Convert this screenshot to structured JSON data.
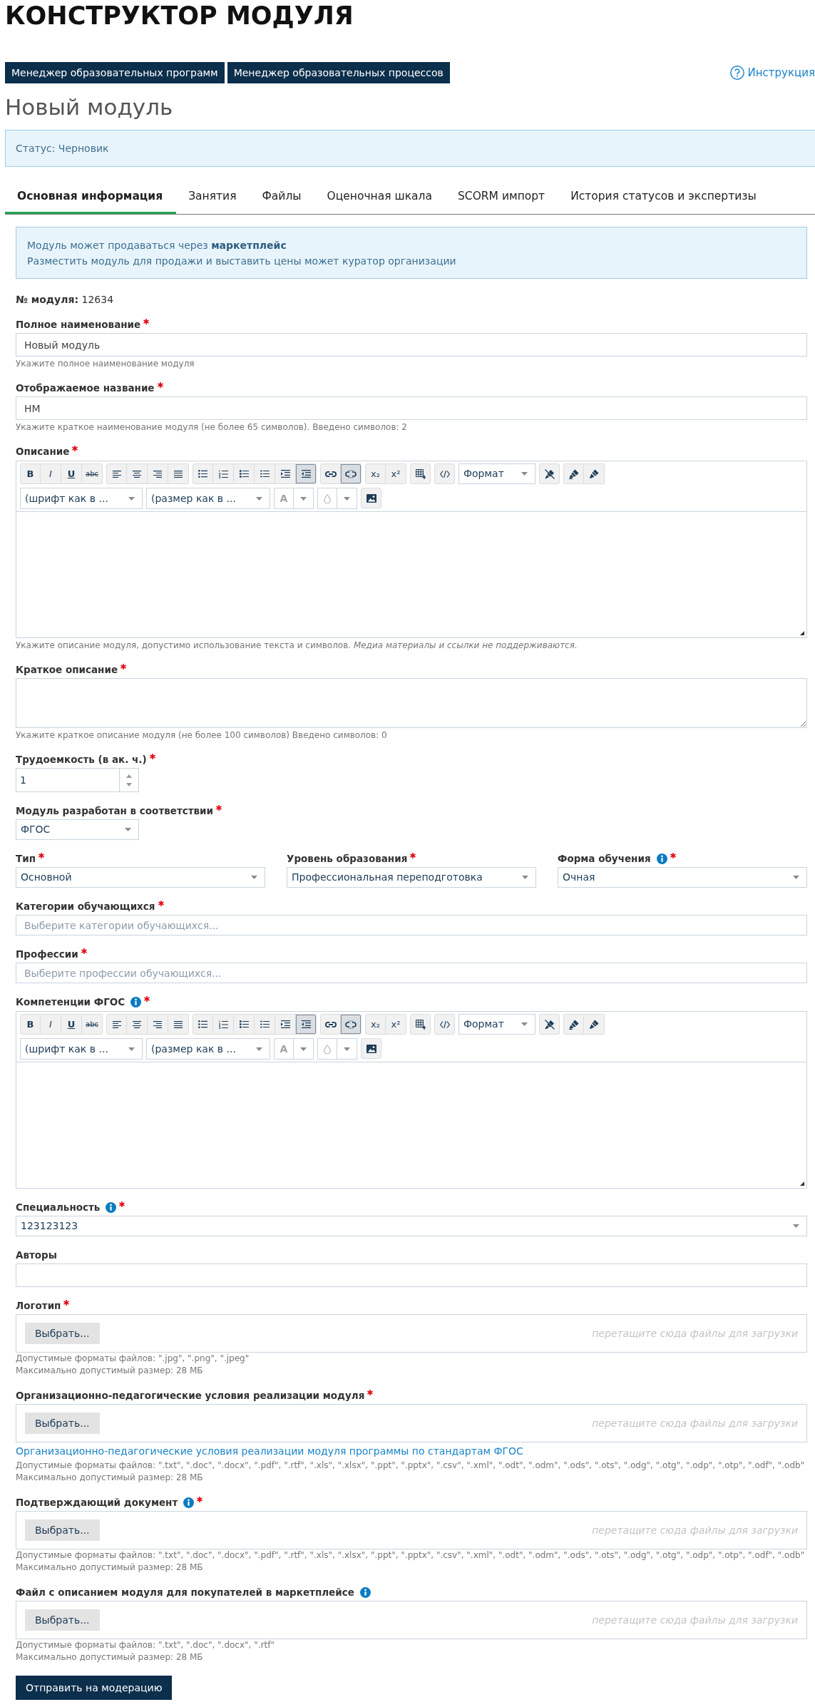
{
  "title": "КОНСТРУКТОР МОДУЛЯ",
  "nav_buttons": [
    "Менеджер образовательных программ",
    "Менеджер образовательных процессов"
  ],
  "help_link": "Инструкция",
  "heading": "Новый модуль",
  "status": "Статус: Черновик",
  "tabs": [
    {
      "label": "Основная информация",
      "selected": true
    },
    {
      "label": "Занятия",
      "selected": false
    },
    {
      "label": "Файлы",
      "selected": false
    },
    {
      "label": "Оценочная шкала",
      "selected": false
    },
    {
      "label": "SCORM импорт",
      "selected": false
    },
    {
      "label": "История статусов и экспертизы",
      "selected": false
    }
  ],
  "notice": [
    "Модуль может продаваться через **маркетплейс**",
    "Разместить модуль для продажи и выставить цены может куратор организации"
  ],
  "module_number": "**№ модуля:** 12634",
  "fields": [
    {
      "kind": "text",
      "label": "Полное наименование",
      "required": true,
      "info": false,
      "value": "Новый модуль",
      "help": [
        "Укажите полное наименование модуля"
      ]
    },
    {
      "kind": "text",
      "label": "Отображаемое название",
      "required": true,
      "info": false,
      "value": "НМ",
      "help": [
        "Укажите краткое наименование модуля (не более 65 символов). Введено символов: 2"
      ]
    },
    {
      "kind": "editor",
      "label": "Описание",
      "required": true,
      "info": false,
      "editor": {
        "tools": [
          {
            "label": "B",
            "pressed": false
          },
          {
            "label": "I",
            "pressed": false
          },
          {
            "label": "U",
            "pressed": false
          },
          {
            "label": "abc",
            "pressed": false
          },
          {
            "pressed": false
          },
          {
            "pressed": false
          },
          {
            "pressed": false
          },
          {
            "pressed": false
          },
          {
            "pressed": false
          },
          {
            "pressed": false
          },
          {
            "pressed": false
          },
          {
            "pressed": false
          },
          {
            "pressed": false
          },
          {
            "pressed": true
          },
          {
            "pressed": false
          },
          {
            "pressed": true
          },
          {
            "label": "x₂",
            "pressed": false
          },
          {
            "label": "x²",
            "pressed": false
          },
          {
            "pressed": false
          },
          {
            "pressed": false
          },
          {
            "pressed": false
          },
          {
            "pressed": false
          },
          {
            "pressed": false
          }
        ],
        "format": "Формат",
        "font": "(шрифт как в ...",
        "size": "(размер как в ...",
        "text_color_label": "A"
      },
      "help": [
        "Укажите описание модуля, допустимо использование текста и символов. *Медиа материалы и ссылки не поддерживаются.*"
      ]
    },
    {
      "kind": "textarea",
      "label": "Краткое описание",
      "required": true,
      "info": false,
      "help": [
        "Укажите краткое описание модуля (не более 100 символов) Введено символов: 0"
      ]
    },
    {
      "kind": "number",
      "label": "Трудоемкость (в ак. ч.)",
      "required": true,
      "info": false,
      "value": "1"
    },
    {
      "kind": "short_select",
      "label": "Модуль разработан в соответствии",
      "required": true,
      "info": false,
      "value": "ФГОС"
    },
    {
      "kind": "columns",
      "columns": [
        {
          "kind": "select",
          "label": "Тип",
          "required": true,
          "info": false,
          "value": "Основной"
        },
        {
          "kind": "select",
          "label": "Уровень образования",
          "required": true,
          "info": false,
          "value": "Профессиональная переподготовка"
        },
        {
          "kind": "select",
          "label": "Форма обучения",
          "required": true,
          "info": true,
          "value": "Очная"
        }
      ]
    },
    {
      "kind": "multiselect",
      "label": "Категории обучающихся",
      "required": true,
      "info": false,
      "placeholder": "Выберите категории обучающихся..."
    },
    {
      "kind": "multiselect",
      "label": "Профессии",
      "required": true,
      "info": false,
      "placeholder": "Выберите профессии обучающихся..."
    },
    {
      "kind": "editor",
      "label": "Компетенции ФГОС",
      "required": true,
      "info": true,
      "editor": {
        "tools": [
          {
            "label": "B",
            "pressed": false
          },
          {
            "label": "I",
            "pressed": false
          },
          {
            "label": "U",
            "pressed": false
          },
          {
            "label": "abc",
            "pressed": false
          },
          {
            "pressed": false
          },
          {
            "pressed": false
          },
          {
            "pressed": false
          },
          {
            "pressed": false
          },
          {
            "pressed": false
          },
          {
            "pressed": false
          },
          {
            "pressed": false
          },
          {
            "pressed": false
          },
          {
            "pressed": false
          },
          {
            "pressed": true
          },
          {
            "pressed": false
          },
          {
            "pressed": true
          },
          {
            "label": "x₂",
            "pressed": false
          },
          {
            "label": "x²",
            "pressed": false
          },
          {
            "pressed": false
          },
          {
            "pressed": false
          },
          {
            "pressed": false
          },
          {
            "pressed": false
          },
          {
            "pressed": false
          }
        ],
        "format": "Формат",
        "font": "(шрифт как в ...",
        "size": "(размер как в ...",
        "text_color_label": "A"
      }
    },
    {
      "kind": "select",
      "label": "Специальность",
      "required": true,
      "info": true,
      "value": "123123123"
    },
    {
      "kind": "text",
      "label": "Авторы",
      "required": false,
      "info": false
    },
    {
      "kind": "file",
      "label": "Логотип",
      "required": true,
      "info": false,
      "button": "Выбрать...",
      "drop_hint": "перетащите сюда файлы для загрузки",
      "help": [
        "Допустимые форматы файлов: \".jpg\", \".png\", \".jpeg\"",
        "Максимально допустимый размер: 28 МБ"
      ]
    },
    {
      "kind": "file",
      "label": "Организационно-педагогические условия реализации модуля",
      "required": true,
      "info": false,
      "button": "Выбрать...",
      "drop_hint": "перетащите сюда файлы для загрузки",
      "link": "Организационно-педагогические условия реализации модуля программы по стандартам ФГОС",
      "help": [
        "Допустимые форматы файлов: \".txt\", \".doc\", \".docx\", \".pdf\", \".rtf\", \".xls\", \".xlsx\", \".ppt\", \".pptx\", \".csv\", \".xml\", \".odt\", \".odm\", \".ods\", \".ots\", \".odg\", \".otg\", \".odp\", \".otp\", \".odf\", \".odb\"",
        "Максимально допустимый размер: 28 МБ"
      ]
    },
    {
      "kind": "file",
      "label": "Подтверждающий документ",
      "required": true,
      "info": true,
      "button": "Выбрать...",
      "drop_hint": "перетащите сюда файлы для загрузки",
      "help": [
        "Допустимые форматы файлов: \".txt\", \".doc\", \".docx\", \".pdf\", \".rtf\", \".xls\", \".xlsx\", \".ppt\", \".pptx\", \".csv\", \".xml\", \".odt\", \".odm\", \".ods\", \".ots\", \".odg\", \".otg\", \".odp\", \".otp\", \".odf\", \".odb\"",
        "Максимально допустимый размер: 28 МБ"
      ]
    },
    {
      "kind": "file",
      "label": "Файл с описанием модуля для покупателей в маркетплейсе",
      "required": false,
      "info": true,
      "button": "Выбрать...",
      "drop_hint": "перетащите сюда файлы для загрузки",
      "help": [
        "Допустимые форматы файлов: \".txt\", \".doc\", \".docx\", \".rtf\"",
        "Максимально допустимый размер: 28 МБ"
      ]
    }
  ],
  "submit_button": "Отправить на модерацию"
}
